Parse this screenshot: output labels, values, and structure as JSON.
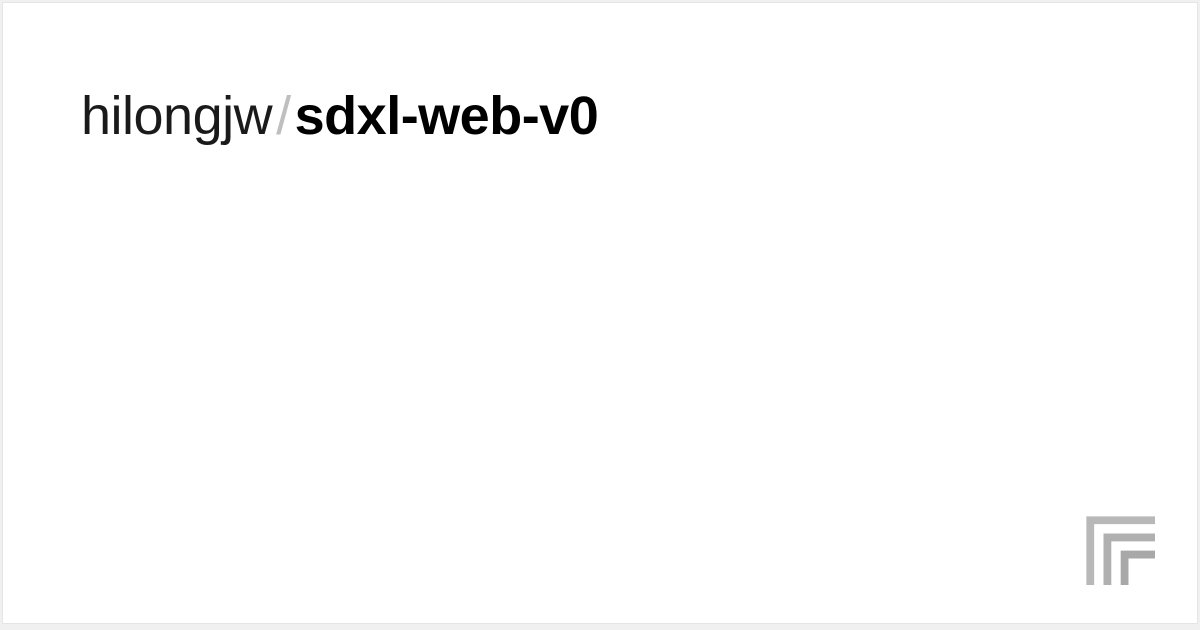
{
  "title": {
    "owner": "hilongjw",
    "separator": "/",
    "repo": "sdxl-web-v0"
  }
}
